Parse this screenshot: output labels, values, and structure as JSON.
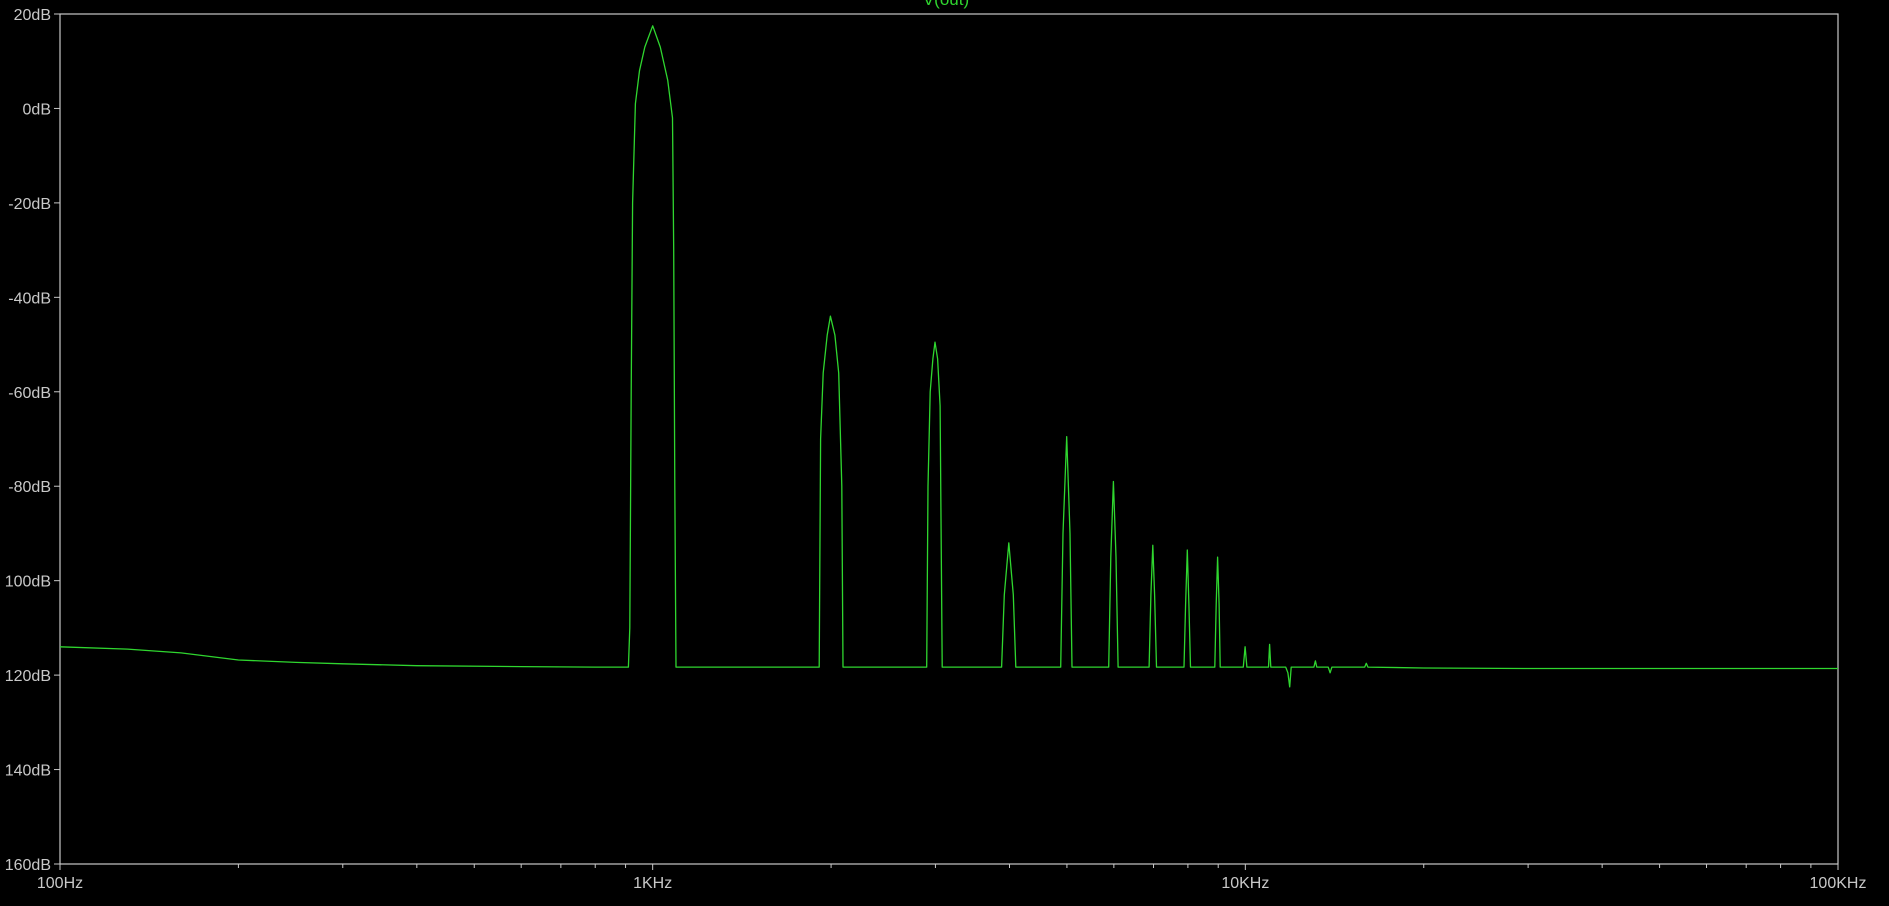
{
  "chart_data": {
    "type": "line",
    "title": "V(out)",
    "xlabel": "",
    "ylabel": "",
    "xscale": "log",
    "xlim": [
      100,
      100000
    ],
    "ylim": [
      -160,
      20
    ],
    "x_ticks": [
      {
        "value": 100,
        "label": "100Hz"
      },
      {
        "value": 1000,
        "label": "1KHz"
      },
      {
        "value": 10000,
        "label": "10KHz"
      },
      {
        "value": 100000,
        "label": "100KHz"
      }
    ],
    "y_ticks": [
      {
        "value": 20,
        "label": "20dB"
      },
      {
        "value": 0,
        "label": "0dB"
      },
      {
        "value": -20,
        "label": "-20dB"
      },
      {
        "value": -40,
        "label": "-40dB"
      },
      {
        "value": -60,
        "label": "-60dB"
      },
      {
        "value": -80,
        "label": "-80dB"
      },
      {
        "value": -100,
        "label": "100dB"
      },
      {
        "value": -120,
        "label": "120dB"
      },
      {
        "value": -140,
        "label": "140dB"
      },
      {
        "value": -160,
        "label": "160dB"
      }
    ],
    "grid": false,
    "colors": {
      "background": "#000000",
      "frame": "#c8c8c8",
      "series": "#2fd62f",
      "text": "#c8c8c8"
    },
    "series": [
      {
        "name": "V(out)",
        "points": [
          [
            100,
            -114
          ],
          [
            130,
            -114.5
          ],
          [
            160,
            -115.3
          ],
          [
            200,
            -116.8
          ],
          [
            250,
            -117.3
          ],
          [
            300,
            -117.6
          ],
          [
            400,
            -118
          ],
          [
            600,
            -118.2
          ],
          [
            800,
            -118.3
          ],
          [
            910,
            -118.3
          ],
          [
            915,
            -110
          ],
          [
            920,
            -60
          ],
          [
            925,
            -20
          ],
          [
            935,
            1
          ],
          [
            950,
            8
          ],
          [
            970,
            13
          ],
          [
            1000,
            17.5
          ],
          [
            1030,
            13
          ],
          [
            1060,
            6
          ],
          [
            1080,
            -2
          ],
          [
            1085,
            -30
          ],
          [
            1090,
            -80
          ],
          [
            1095,
            -118.3
          ],
          [
            1910,
            -118.3
          ],
          [
            1920,
            -70
          ],
          [
            1940,
            -56
          ],
          [
            1970,
            -48
          ],
          [
            1995,
            -44
          ],
          [
            2030,
            -48
          ],
          [
            2060,
            -56
          ],
          [
            2085,
            -80
          ],
          [
            2095,
            -118.3
          ],
          [
            2900,
            -118.3
          ],
          [
            2915,
            -80
          ],
          [
            2940,
            -60
          ],
          [
            2970,
            -53
          ],
          [
            2995,
            -49.5
          ],
          [
            3025,
            -53
          ],
          [
            3055,
            -63
          ],
          [
            3080,
            -118.3
          ],
          [
            3880,
            -118.3
          ],
          [
            3920,
            -103
          ],
          [
            3990,
            -92
          ],
          [
            4060,
            -103
          ],
          [
            4100,
            -118.3
          ],
          [
            4880,
            -118.3
          ],
          [
            4925,
            -90
          ],
          [
            4995,
            -69.5
          ],
          [
            5060,
            -90
          ],
          [
            5100,
            -118.3
          ],
          [
            5880,
            -118.3
          ],
          [
            5930,
            -95
          ],
          [
            5990,
            -79
          ],
          [
            6050,
            -95
          ],
          [
            6100,
            -118.3
          ],
          [
            6880,
            -118.3
          ],
          [
            6930,
            -103
          ],
          [
            6980,
            -92.5
          ],
          [
            7030,
            -103
          ],
          [
            7080,
            -118.3
          ],
          [
            7880,
            -118.3
          ],
          [
            7930,
            -105
          ],
          [
            7980,
            -93.5
          ],
          [
            8030,
            -105
          ],
          [
            8080,
            -118.3
          ],
          [
            8880,
            -118.3
          ],
          [
            8930,
            -105
          ],
          [
            8980,
            -95
          ],
          [
            9030,
            -105
          ],
          [
            9070,
            -118.3
          ],
          [
            9920,
            -118.3
          ],
          [
            9990,
            -114
          ],
          [
            10060,
            -118.3
          ],
          [
            10940,
            -118.3
          ],
          [
            10990,
            -113.5
          ],
          [
            11040,
            -118.3
          ],
          [
            11700,
            -118.3
          ],
          [
            11800,
            -119.5
          ],
          [
            11880,
            -122.5
          ],
          [
            11950,
            -118.3
          ],
          [
            13050,
            -118.3
          ],
          [
            13130,
            -117
          ],
          [
            13200,
            -118.3
          ],
          [
            13800,
            -118.3
          ],
          [
            13900,
            -119.5
          ],
          [
            14000,
            -118.3
          ],
          [
            15900,
            -118.3
          ],
          [
            16000,
            -117.5
          ],
          [
            16100,
            -118.3
          ],
          [
            20000,
            -118.5
          ],
          [
            30000,
            -118.6
          ],
          [
            50000,
            -118.6
          ],
          [
            100000,
            -118.6
          ]
        ]
      }
    ]
  }
}
